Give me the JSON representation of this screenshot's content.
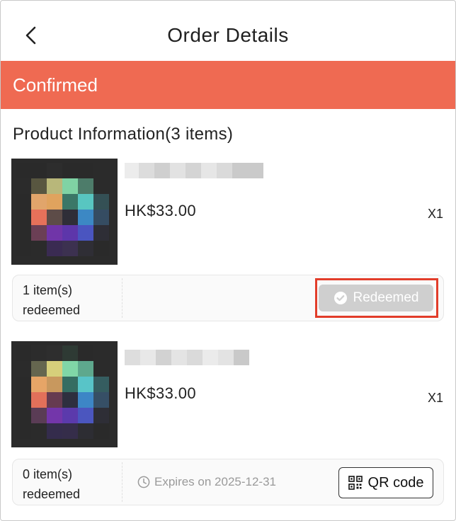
{
  "header": {
    "title": "Order Details",
    "back_icon": "chevron-left-icon"
  },
  "status": {
    "label": "Confirmed",
    "color": "#ef6a52"
  },
  "section": {
    "title": "Product Information(3 items)"
  },
  "products": [
    {
      "price": "HK$33.00",
      "qty": "X1",
      "redeem_count": "1 item(s) redeemed",
      "action": {
        "label": "Redeemed",
        "icon": "check-circle-icon",
        "state": "disabled"
      }
    },
    {
      "price": "HK$33.00",
      "qty": "X1",
      "redeem_count": "0 item(s) redeemed",
      "expires": "Expires on 2025-12-31",
      "expires_icon": "clock-icon",
      "action": {
        "label": "QR code",
        "icon": "qr-code-icon"
      }
    }
  ],
  "colors": {
    "accent": "#ef6a52",
    "highlight": "#e23d2a",
    "disabled_button": "#cfcfcf"
  }
}
